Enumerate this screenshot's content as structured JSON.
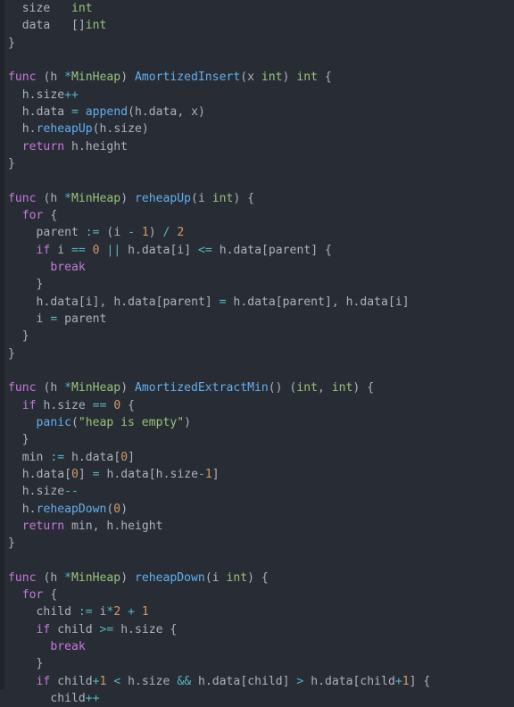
{
  "editor": {
    "language": "go",
    "theme": "one-dark",
    "background": "#282c34",
    "gutter_color": "#21252b",
    "foreground": "#abb2bf",
    "colors": {
      "keyword": "#c678dd",
      "function": "#61afef",
      "type": "#98c379",
      "string": "#98c379",
      "number": "#d19a66",
      "operator": "#56b6c2",
      "punctuation": "#abb2bf",
      "variable": "#abb2bf"
    }
  },
  "code": {
    "lines": [
      "  size   int",
      "  data   []int",
      "}",
      "",
      "func (h *MinHeap) AmortizedInsert(x int) int {",
      "  h.size++",
      "  h.data = append(h.data, x)",
      "  h.reheapUp(h.size)",
      "  return h.height",
      "}",
      "",
      "func (h *MinHeap) reheapUp(i int) {",
      "  for {",
      "    parent := (i - 1) / 2",
      "    if i == 0 || h.data[i] <= h.data[parent] {",
      "      break",
      "    }",
      "    h.data[i], h.data[parent] = h.data[parent], h.data[i]",
      "    i = parent",
      "  }",
      "}",
      "",
      "func (h *MinHeap) AmortizedExtractMin() (int, int) {",
      "  if h.size == 0 {",
      "    panic(\"heap is empty\")",
      "  }",
      "  min := h.data[0]",
      "  h.data[0] = h.data[h.size-1]",
      "  h.size--",
      "  h.reheapDown(0)",
      "  return min, h.height",
      "}",
      "",
      "func (h *MinHeap) reheapDown(i int) {",
      "  for {",
      "    child := i*2 + 1",
      "    if child >= h.size {",
      "      break",
      "    }",
      "    if child+1 < h.size && h.data[child] > h.data[child+1] {",
      "      child++"
    ],
    "identifiers": {
      "struct_fields": [
        "size",
        "data"
      ],
      "methods": [
        "AmortizedInsert",
        "reheapUp",
        "AmortizedExtractMin",
        "reheapDown"
      ],
      "receiver": "h *MinHeap",
      "builtins": [
        "append",
        "panic"
      ],
      "keywords": [
        "func",
        "return",
        "for",
        "if",
        "break"
      ],
      "types": [
        "int",
        "[]int"
      ],
      "strings": [
        "\"heap is empty\""
      ],
      "numbers": [
        "0",
        "1",
        "2"
      ],
      "locals": [
        "parent",
        "min",
        "child",
        "i",
        "x"
      ]
    }
  }
}
